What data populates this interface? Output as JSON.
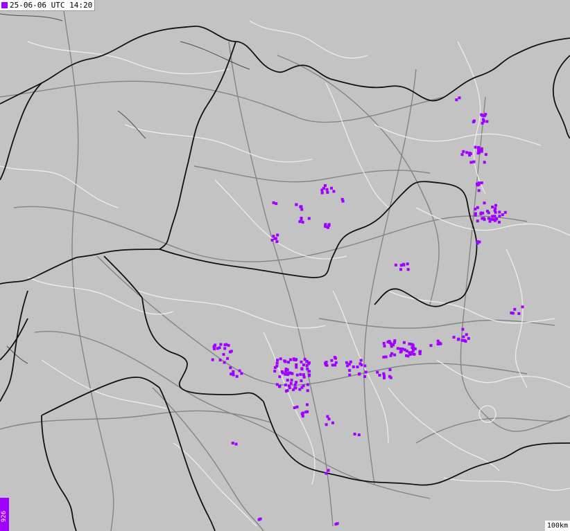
{
  "map": {
    "timestamp": "25-06-06 UTC 14:20",
    "stroke_count": "926",
    "scale_label": "100km",
    "colors": {
      "land": "#c3c3c3",
      "country_border": "#111111",
      "region_border": "#ffffff",
      "road": "#7a7a7a",
      "lightning": "#a000ff"
    }
  }
}
